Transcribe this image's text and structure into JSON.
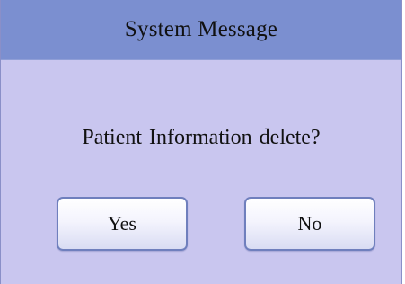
{
  "dialog": {
    "title": "System Message",
    "message": "Patient Information  delete?",
    "buttons": {
      "yes_label": "Yes",
      "no_label": "No"
    }
  },
  "colors": {
    "titlebar": "#7b8fd0",
    "body": "#c9c6ef",
    "button_border": "#6f7fbd"
  }
}
